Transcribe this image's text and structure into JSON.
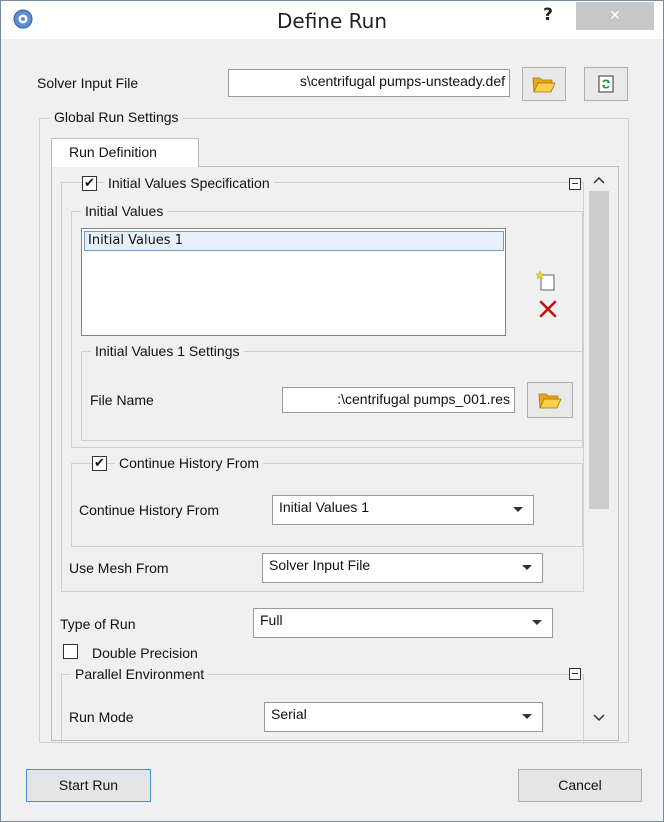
{
  "window": {
    "title": "Define Run",
    "help": "?",
    "close": "×",
    "icons": {
      "app": "gear-icon",
      "close": "close-icon"
    }
  },
  "solver_input": {
    "label": "Solver Input File",
    "value": "s\\centrifugal pumps-unsteady.def",
    "browse_icon": "folder-open-icon",
    "reload_icon": "reload-icon"
  },
  "global_settings": {
    "title": "Global Run Settings",
    "tab": "Run Definition",
    "initial_values_spec": {
      "label": "Initial Values Specification",
      "checked": true,
      "initial_values_group": "Initial Values",
      "list_items": [
        "Initial Values 1"
      ],
      "new_icon": "new-item-icon",
      "delete_icon": "delete-icon",
      "settings": {
        "title": "Initial Values 1 Settings",
        "file_name_label": "File Name",
        "file_name_value": ":\\centrifugal pumps_001.res"
      },
      "continue_history": {
        "checkbox_label": "Continue History From",
        "checked": true,
        "field_label": "Continue History From",
        "value": "Initial Values 1"
      },
      "use_mesh": {
        "label": "Use Mesh From",
        "value": "Solver Input File"
      }
    },
    "type_of_run": {
      "label": "Type of Run",
      "value": "Full"
    },
    "double_precision": {
      "label": "Double Precision",
      "checked": false
    },
    "parallel_env": {
      "title": "Parallel Environment",
      "run_mode_label": "Run Mode",
      "run_mode_value": "Serial"
    }
  },
  "footer": {
    "start": "Start Run",
    "cancel": "Cancel"
  },
  "colors": {
    "window_bg": "#f0f0f0",
    "folder": "#f2b934",
    "delete": "#c41212",
    "selection": "#e6f0fa"
  }
}
